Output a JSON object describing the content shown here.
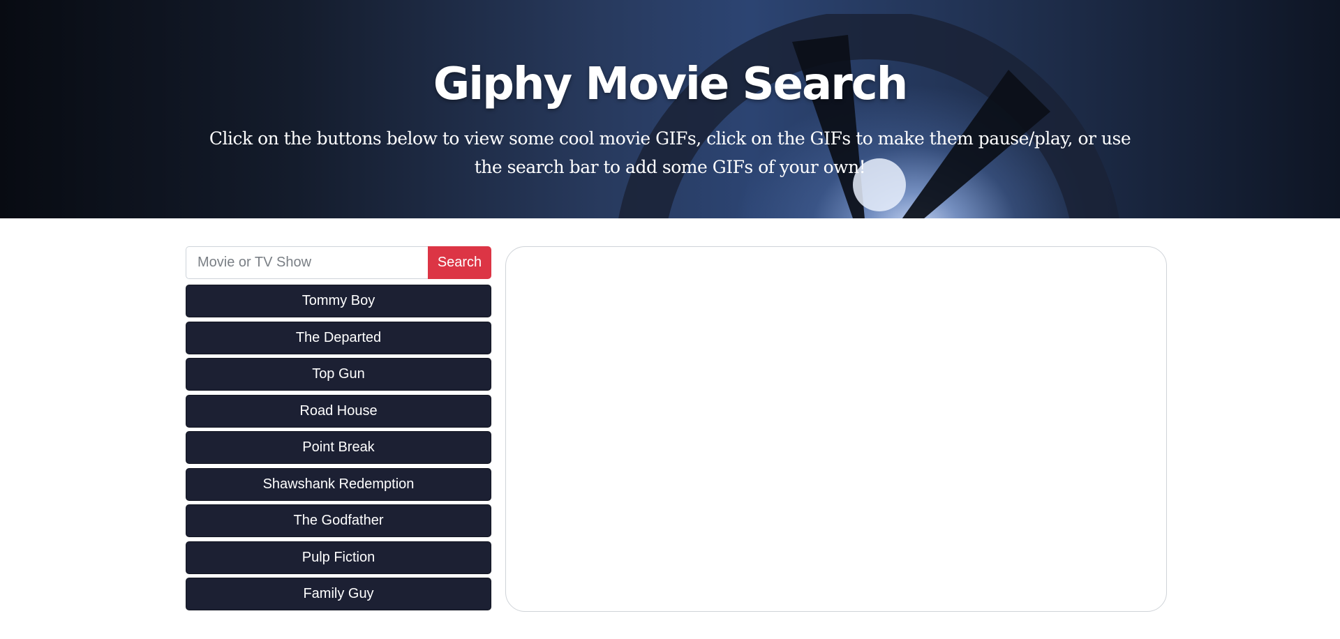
{
  "header": {
    "title": "Giphy Movie Search",
    "subtitle": "Click on the buttons below to view some cool movie GIFs, click on the GIFs to make them pause/play, or use the search bar to add some GIFs of your own!"
  },
  "search": {
    "placeholder": "Movie or TV Show",
    "value": "",
    "button_label": "Search"
  },
  "movies": [
    "Tommy Boy",
    "The Departed",
    "Top Gun",
    "Road House",
    "Point Break",
    "Shawshank Redemption",
    "The Godfather",
    "Pulp Fiction",
    "Family Guy"
  ],
  "colors": {
    "search_button": "#dc3545",
    "movie_button": "#1c2033"
  }
}
